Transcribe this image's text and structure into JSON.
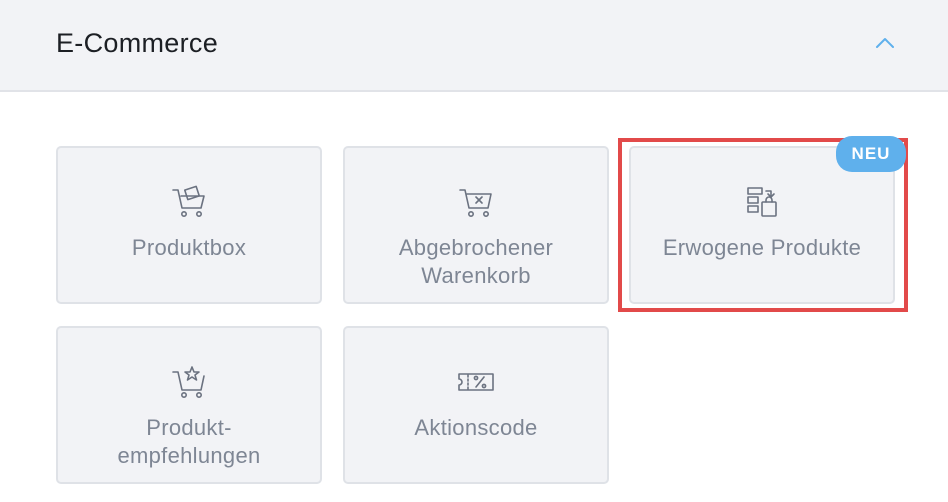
{
  "section": {
    "title": "E-Commerce",
    "collapse_icon": "chevron-up-icon"
  },
  "tiles": [
    {
      "id": "produktbox",
      "label": "Produktbox",
      "icon": "cart-box-icon"
    },
    {
      "id": "abgebrochener-warenkorb",
      "label_line1": "Abgebrochener",
      "label_line2": "Warenkorb",
      "icon": "cart-x-icon"
    },
    {
      "id": "erwogene-produkte",
      "label": "Erwogene Produkte",
      "icon": "considered-products-icon",
      "badge": "NEU",
      "highlighted": true
    },
    {
      "id": "produktempfehlungen",
      "label_line1": "Produkt-",
      "label_line2": "empfehlungen",
      "icon": "cart-star-icon"
    },
    {
      "id": "aktionscode",
      "label": "Aktionscode",
      "icon": "coupon-percent-icon"
    }
  ],
  "colors": {
    "header_bg": "#f2f3f6",
    "tile_bg": "#f2f3f6",
    "tile_text": "#7e8694",
    "accent": "#5fb0ec",
    "highlight": "#e24a4a"
  }
}
